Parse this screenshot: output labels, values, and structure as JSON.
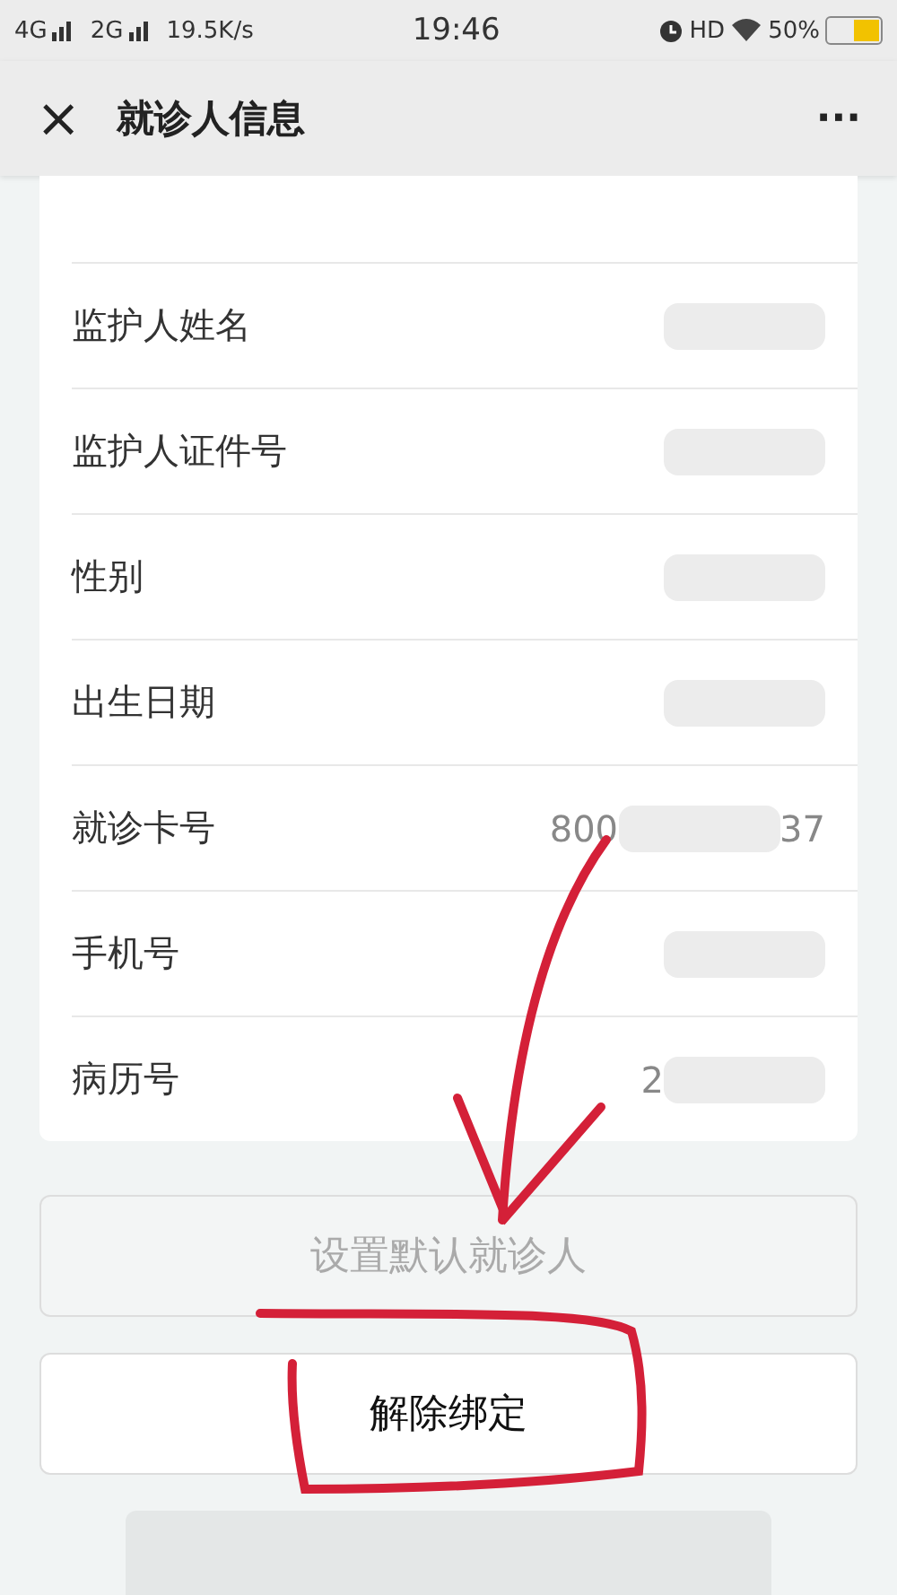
{
  "status_bar": {
    "left": "4G",
    "left_2": "2G",
    "speed": "19.5K/s",
    "time": "19:46",
    "hd": "HD",
    "battery": "50%"
  },
  "header": {
    "close": "×",
    "title": "就诊人信息",
    "more": "···"
  },
  "rows": [
    {
      "label": "监护人姓名",
      "redacted": true
    },
    {
      "label": "监护人证件号",
      "redacted": true
    },
    {
      "label": "性别",
      "redacted": true
    },
    {
      "label": "出生日期",
      "redacted": true
    },
    {
      "label": "就诊卡号",
      "value_start": "800",
      "value_end": "37",
      "redacted": true
    },
    {
      "label": "手机号",
      "redacted": true
    },
    {
      "label": "病历号",
      "value_start": "2",
      "redacted": true
    }
  ],
  "buttons": [
    {
      "label": "设置默认就诊人",
      "disabled": true
    },
    {
      "label": "解除绑定",
      "disabled": false
    }
  ]
}
